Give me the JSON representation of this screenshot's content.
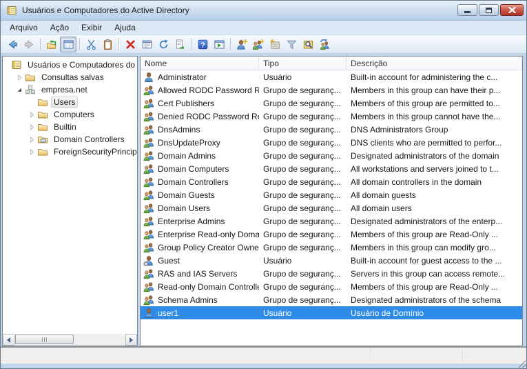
{
  "window": {
    "title": "Usuários e Computadores do Active Directory",
    "controls": [
      "minimize",
      "maximize",
      "close"
    ]
  },
  "menu": {
    "items": [
      "Arquivo",
      "Ação",
      "Exibir",
      "Ajuda"
    ]
  },
  "toolbar": {
    "items": [
      {
        "icon": "back-icon"
      },
      {
        "icon": "forward-icon"
      },
      {
        "separator": true
      },
      {
        "icon": "up-level-icon"
      },
      {
        "icon": "console-tree-icon",
        "pressed": true
      },
      {
        "separator": true
      },
      {
        "icon": "cut-icon"
      },
      {
        "icon": "paste-icon"
      },
      {
        "separator": true
      },
      {
        "icon": "delete-icon"
      },
      {
        "icon": "properties-icon"
      },
      {
        "icon": "refresh-icon"
      },
      {
        "icon": "export-list-icon"
      },
      {
        "separator": true
      },
      {
        "icon": "help-icon"
      },
      {
        "icon": "new-window-icon"
      },
      {
        "separator": true
      },
      {
        "icon": "new-user-icon"
      },
      {
        "icon": "new-group-icon"
      },
      {
        "icon": "new-ou-icon"
      },
      {
        "icon": "filter-icon"
      },
      {
        "icon": "find-icon"
      },
      {
        "icon": "change-user-icon"
      }
    ]
  },
  "tree": {
    "items": [
      {
        "label": "Usuários e Computadores do Ac",
        "level": 0,
        "expander": "none",
        "icon": "console-icon",
        "selected": false
      },
      {
        "label": "Consultas salvas",
        "level": 1,
        "expander": "collapsed",
        "icon": "folder-icon",
        "selected": false
      },
      {
        "label": "empresa.net",
        "level": 1,
        "expander": "expanded",
        "icon": "domain-icon",
        "selected": false
      },
      {
        "label": "Users",
        "level": 2,
        "expander": "none",
        "icon": "folder-icon",
        "selected": true
      },
      {
        "label": "Computers",
        "level": 2,
        "expander": "collapsed",
        "icon": "folder-icon",
        "selected": false
      },
      {
        "label": "Builtin",
        "level": 2,
        "expander": "collapsed",
        "icon": "folder-icon",
        "selected": false
      },
      {
        "label": "Domain Controllers",
        "level": 2,
        "expander": "collapsed",
        "icon": "folder-dc-icon",
        "selected": false
      },
      {
        "label": "ForeignSecurityPrincipals",
        "level": 2,
        "expander": "collapsed",
        "icon": "folder-icon",
        "selected": false
      }
    ]
  },
  "list": {
    "columns": [
      "Nome",
      "Tipo",
      "Descrição"
    ],
    "rows": [
      {
        "name": "Administrator",
        "type": "Usuário",
        "description": "Built-in account for administering the c...",
        "icon": "user-icon",
        "selected": false
      },
      {
        "name": "Allowed RODC Password Re...",
        "type": "Grupo de seguranç...",
        "description": "Members in this group can have their p...",
        "icon": "group-icon",
        "selected": false
      },
      {
        "name": "Cert Publishers",
        "type": "Grupo de seguranç...",
        "description": "Members of this group are permitted to...",
        "icon": "group-icon",
        "selected": false
      },
      {
        "name": "Denied RODC Password Repl...",
        "type": "Grupo de seguranç...",
        "description": "Members in this group cannot have the...",
        "icon": "group-icon",
        "selected": false
      },
      {
        "name": "DnsAdmins",
        "type": "Grupo de seguranç...",
        "description": "DNS Administrators Group",
        "icon": "group-icon",
        "selected": false
      },
      {
        "name": "DnsUpdateProxy",
        "type": "Grupo de seguranç...",
        "description": "DNS clients who are permitted to perfor...",
        "icon": "group-icon",
        "selected": false
      },
      {
        "name": "Domain Admins",
        "type": "Grupo de seguranç...",
        "description": "Designated administrators of the domain",
        "icon": "group-icon",
        "selected": false
      },
      {
        "name": "Domain Computers",
        "type": "Grupo de seguranç...",
        "description": "All workstations and servers joined to t...",
        "icon": "group-icon",
        "selected": false
      },
      {
        "name": "Domain Controllers",
        "type": "Grupo de seguranç...",
        "description": "All domain controllers in the domain",
        "icon": "group-icon",
        "selected": false
      },
      {
        "name": "Domain Guests",
        "type": "Grupo de seguranç...",
        "description": "All domain guests",
        "icon": "group-icon",
        "selected": false
      },
      {
        "name": "Domain Users",
        "type": "Grupo de seguranç...",
        "description": "All domain users",
        "icon": "group-icon",
        "selected": false
      },
      {
        "name": "Enterprise Admins",
        "type": "Grupo de seguranç...",
        "description": "Designated administrators of the enterp...",
        "icon": "group-icon",
        "selected": false
      },
      {
        "name": "Enterprise Read-only Domai...",
        "type": "Grupo de seguranç...",
        "description": "Members of this group are Read-Only ...",
        "icon": "group-icon",
        "selected": false
      },
      {
        "name": "Group Policy Creator Owners",
        "type": "Grupo de seguranç...",
        "description": "Members in this group can modify gro...",
        "icon": "group-icon",
        "selected": false
      },
      {
        "name": "Guest",
        "type": "Usuário",
        "description": "Built-in account for guest access to the ...",
        "icon": "user-disabled-icon",
        "selected": false
      },
      {
        "name": "RAS and IAS Servers",
        "type": "Grupo de seguranç...",
        "description": "Servers in this group can access remote...",
        "icon": "group-icon",
        "selected": false
      },
      {
        "name": "Read-only Domain Controllers",
        "type": "Grupo de seguranç...",
        "description": "Members of this group are Read-Only ...",
        "icon": "group-icon",
        "selected": false
      },
      {
        "name": "Schema Admins",
        "type": "Grupo de seguranç...",
        "description": "Designated administrators of the schema",
        "icon": "group-icon",
        "selected": false
      },
      {
        "name": "user1",
        "type": "Usuário",
        "description": "Usuário de Domínio",
        "icon": "user-icon",
        "selected": true
      }
    ]
  },
  "colors": {
    "selection": "#2e8ce8",
    "close_button": "#b03424",
    "frame": "#bfd5ec"
  }
}
